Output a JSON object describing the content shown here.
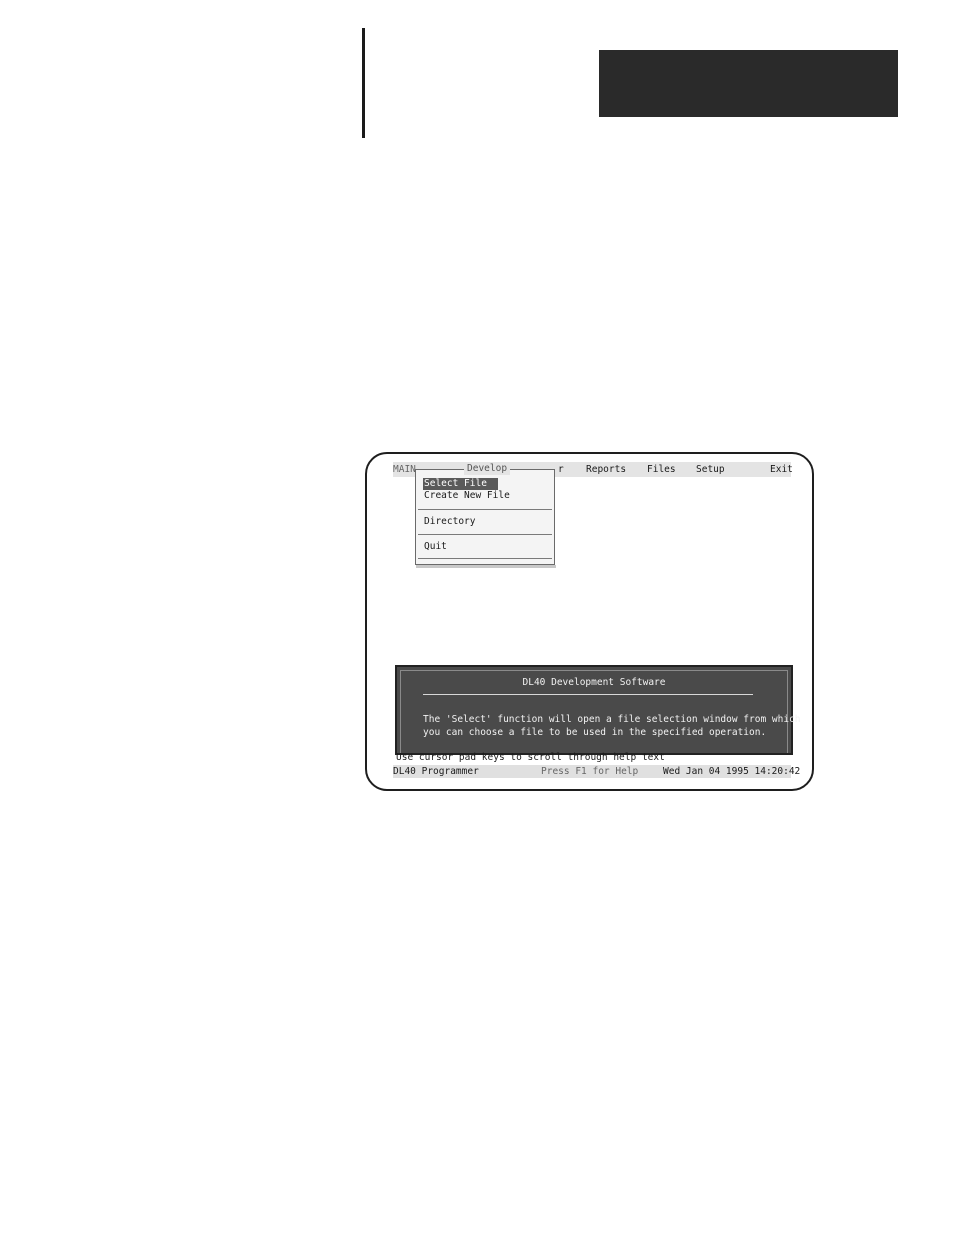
{
  "menubar": {
    "main": "MAIN",
    "partial": "r",
    "reports": "Reports",
    "files": "Files",
    "setup": "Setup",
    "exit": "Exit"
  },
  "dropdown": {
    "title": "Develop",
    "items": [
      "Select File",
      "Create New File",
      "Directory",
      "Quit"
    ],
    "selected_index": 0
  },
  "help": {
    "title": "DL40 Development Software",
    "lines": [
      "The 'Select' function will open a file selection window from which",
      "you can choose a file to be used in the specified operation."
    ]
  },
  "status": {
    "hint": "Use cursor pad keys to scroll through help text",
    "program": "DL40 Programmer",
    "help_key": "Press F1 for Help",
    "datetime": "Wed Jan 04 1995 14:20:42"
  },
  "colors": {
    "header_block": "#2a2a2a",
    "help_background": "#4a4a4a",
    "menu_background": "#e4e4e4"
  }
}
